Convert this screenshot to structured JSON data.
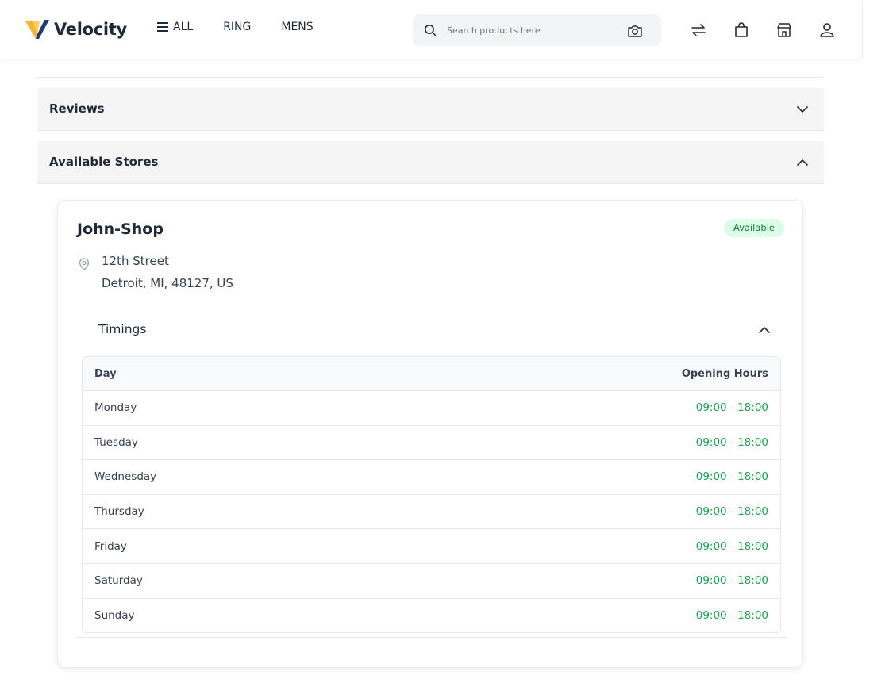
{
  "header": {
    "brand": "Velocity",
    "nav": {
      "all": "ALL",
      "ring": "RING",
      "mens": "MENS"
    },
    "search_placeholder": "Search products here"
  },
  "sections": {
    "reviews": "Reviews",
    "available_stores": "Available Stores"
  },
  "store": {
    "name": "John-Shop",
    "status": "Available",
    "address_line1": "12th Street",
    "address_line2": "Detroit, MI, 48127, US",
    "timings_label": "Timings",
    "table_headers": {
      "day": "Day",
      "hours": "Opening Hours"
    },
    "timings": [
      {
        "day": "Monday",
        "hours": "09:00 - 18:00"
      },
      {
        "day": "Tuesday",
        "hours": "09:00 - 18:00"
      },
      {
        "day": "Wednesday",
        "hours": "09:00 - 18:00"
      },
      {
        "day": "Thursday",
        "hours": "09:00 - 18:00"
      },
      {
        "day": "Friday",
        "hours": "09:00 - 18:00"
      },
      {
        "day": "Saturday",
        "hours": "09:00 - 18:00"
      },
      {
        "day": "Sunday",
        "hours": "09:00 - 18:00"
      }
    ]
  },
  "colors": {
    "brand_accent": "#f5b82e",
    "available_green": "#16a34a",
    "badge_bg": "#dcfce7"
  },
  "icons": [
    "menu-icon",
    "search-icon",
    "camera-icon",
    "compare-icon",
    "bag-icon",
    "store-icon",
    "user-icon",
    "chevron-down-icon",
    "chevron-up-icon",
    "location-pin-icon"
  ]
}
